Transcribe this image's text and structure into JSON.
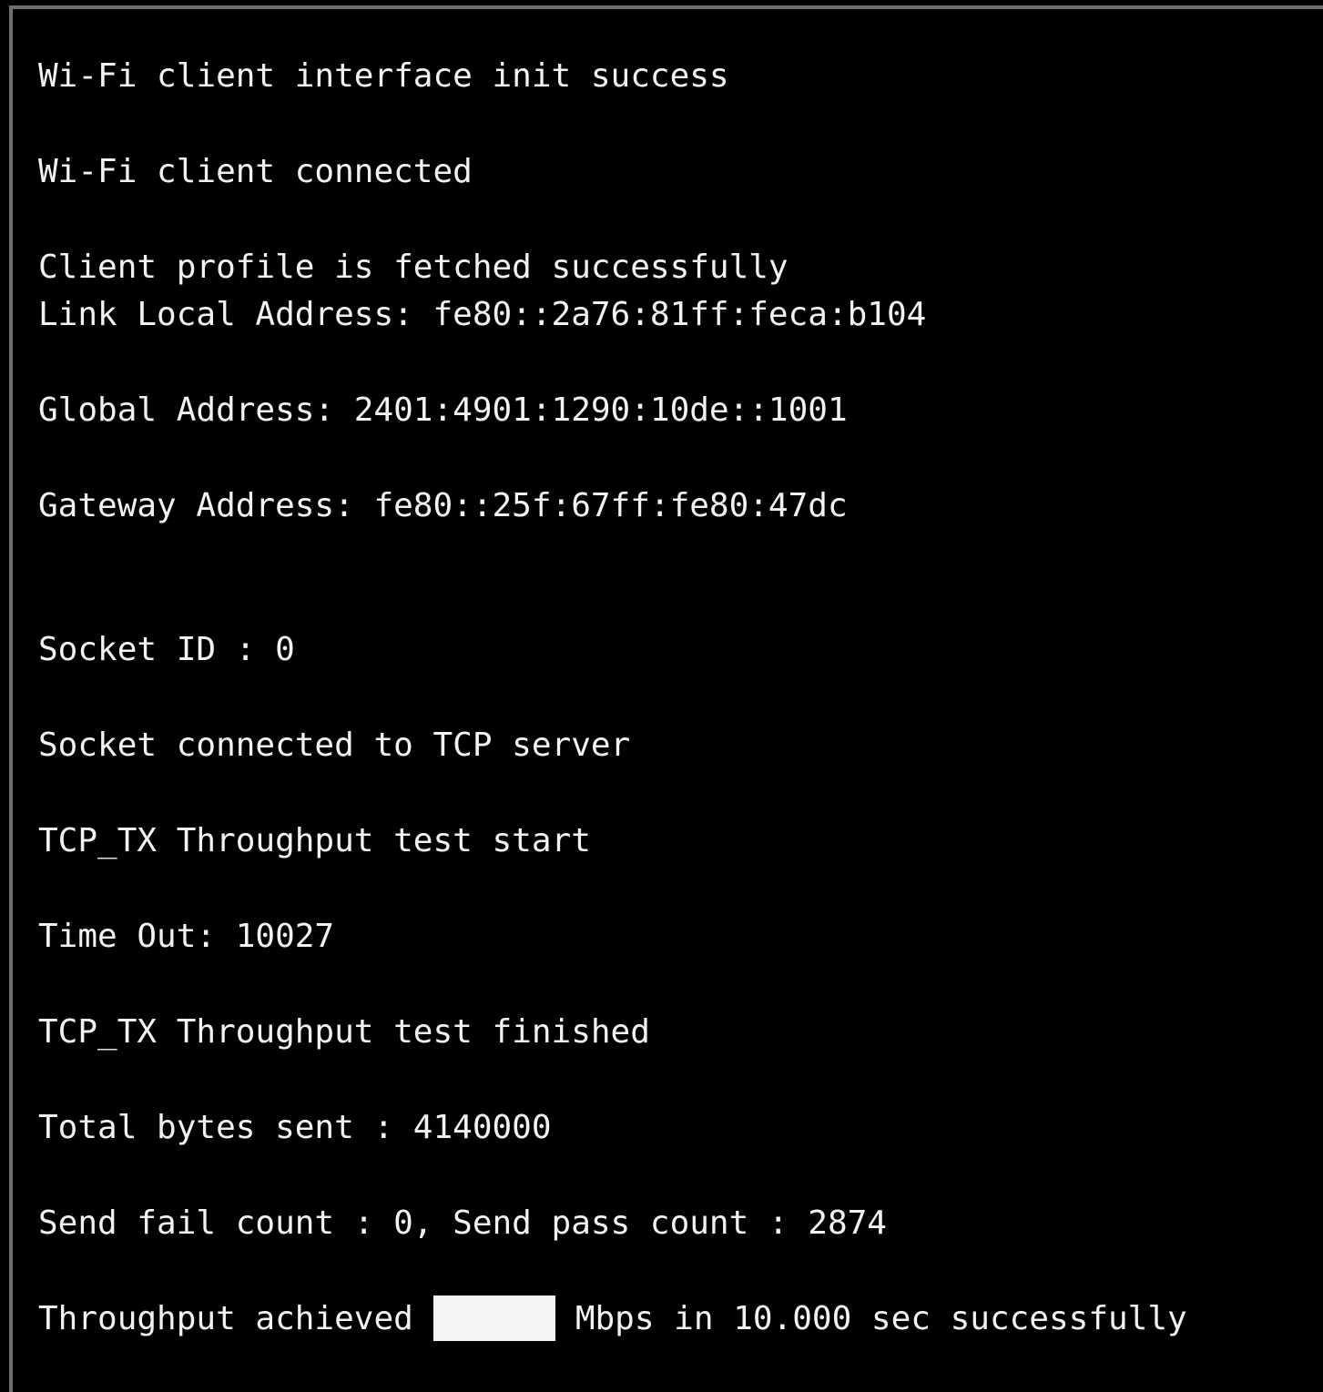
{
  "terminal": {
    "lines": {
      "l1": "Wi-Fi client interface init success",
      "l2": "Wi-Fi client connected",
      "l3": "Client profile is fetched successfully",
      "l4": "Link Local Address: fe80::2a76:81ff:feca:b104",
      "l5": "Global Address: 2401:4901:1290:10de::1001",
      "l6": "Gateway Address: fe80::25f:67ff:fe80:47dc",
      "l7": "Socket ID : 0",
      "l8": "Socket connected to TCP server",
      "l9": "TCP_TX Throughput test start",
      "l10": "Time Out: 10027",
      "l11": "TCP_TX Throughput test finished",
      "l12": "Total bytes sent : 4140000",
      "l13": "Send fail count : 0, Send pass count : 2874"
    },
    "throughput": {
      "prefix": "Throughput achieved",
      "suffix": "Mbps in 10.000 sec successfully"
    }
  }
}
